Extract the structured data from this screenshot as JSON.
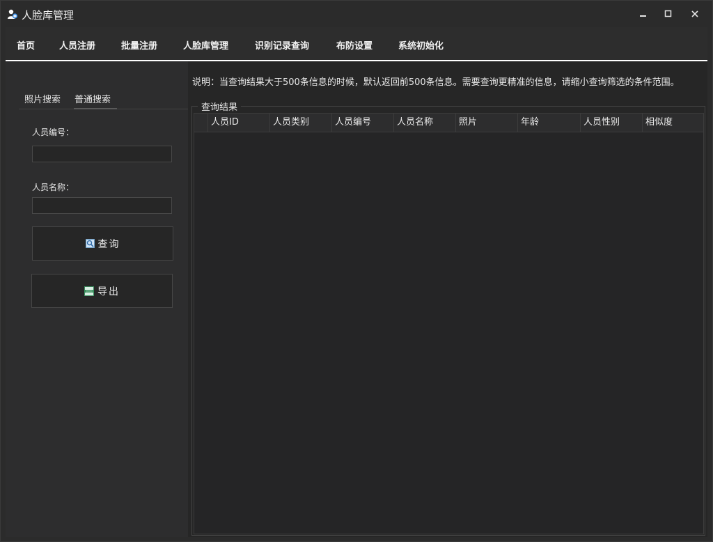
{
  "window": {
    "title": "人脸库管理",
    "controls": {
      "minimize": "▁",
      "maximize": "☐",
      "close": "✕"
    }
  },
  "menu": {
    "items": [
      "首页",
      "人员注册",
      "批量注册",
      "人脸库管理",
      "识别记录查询",
      "布防设置",
      "系统初始化"
    ]
  },
  "note": "说明：当查询结果大于500条信息的时候，默认返回前500条信息。需要查询更精准的信息，请缩小查询筛选的条件范围。",
  "search": {
    "tabs": [
      "照片搜索",
      "普通搜索"
    ],
    "active_tab": "普通搜索",
    "person_no_label": "人员编号：",
    "person_no_value": "",
    "person_name_label": "人员名称：",
    "person_name_value": "",
    "query_button": "查询",
    "export_button": "导出",
    "query_icon": "magnifier-icon",
    "export_icon": "xlsx-file-icon"
  },
  "results": {
    "title": "查询结果",
    "columns": [
      "人员ID",
      "人员类别",
      "人员编号",
      "人员名称",
      "照片",
      "年龄",
      "人员性别",
      "相似度"
    ],
    "rows": []
  },
  "colors": {
    "background": "#2b2b2b",
    "panel": "#2d2d2e",
    "table": "#252526",
    "menu_underline": "#ffffff",
    "icon_blue": "#3a8ee6"
  }
}
